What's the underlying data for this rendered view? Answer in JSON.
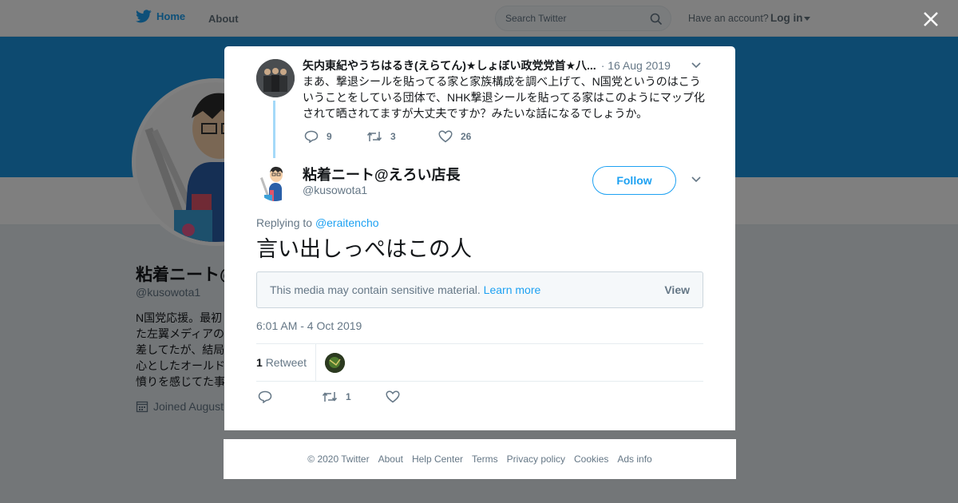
{
  "topbar": {
    "home_label": "Home",
    "about_label": "About",
    "search_placeholder": "Search Twitter",
    "have_account": "Have an account?",
    "login_label": "Log in"
  },
  "profile": {
    "name": "粘着ニート@えろい店長",
    "handle": "@kusowota1",
    "bio_lines": [
      "N国党応援。最初",
      "た左翼メディアの",
      "差してたが、結局",
      "心としたオールド",
      "憤りを感じてた事"
    ],
    "joined": "Joined August"
  },
  "parent_tweet": {
    "author": "矢内東紀やうちはるき(えらてん)★しょぼい政党党首★八...",
    "date": "· 16 Aug 2019",
    "text": "まあ、撃退シールを貼ってる家と家族構成を調べ上げて、N国党というのはこういうことをしている団体で、NHK撃退シールを貼ってる家はこのようにマップ化されて晒されてますが大丈夫ですか？みたいな話になるでしょうか。",
    "replies": "9",
    "retweets": "3",
    "likes": "26"
  },
  "main_tweet": {
    "author_name": "粘着ニート@えろい店長",
    "author_handle": "@kusowota1",
    "follow_label": "Follow",
    "replying_prefix": "Replying to",
    "replying_to": "@eraitencho",
    "text": "言い出しっぺはこの人",
    "sensitive_msg": "This media may contain sensitive material.",
    "learn_more": "Learn more",
    "view_label": "View",
    "timestamp": "6:01 AM - 4 Oct 2019",
    "retweet_count": "1",
    "retweet_label": "Retweet",
    "action_retweets": "1"
  },
  "footer": {
    "items": [
      "© 2020 Twitter",
      "About",
      "Help Center",
      "Terms",
      "Privacy policy",
      "Cookies",
      "Ads info"
    ]
  },
  "colors": {
    "accent": "#1da1f2",
    "banner": "#1b95e0",
    "muted": "#657786"
  }
}
